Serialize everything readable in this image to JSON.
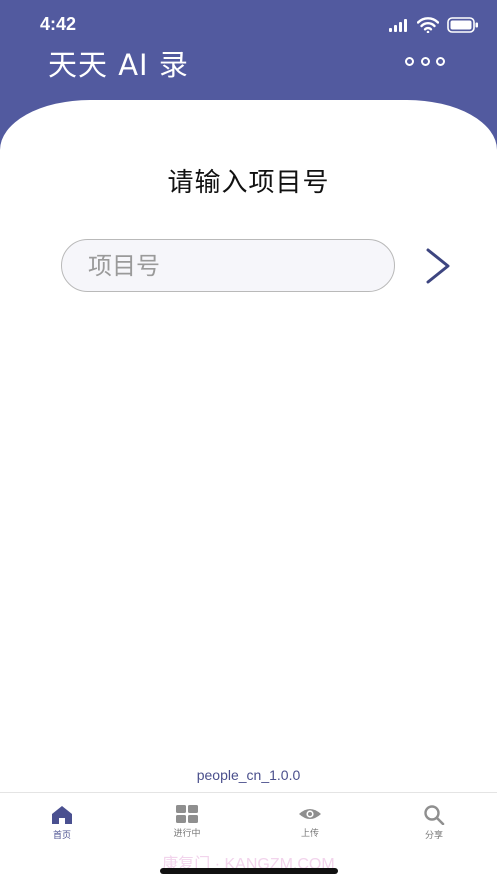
{
  "status_bar": {
    "time": "4:42"
  },
  "header": {
    "title": "天天 AI 录"
  },
  "main": {
    "prompt": "请输入项目号",
    "project_input": {
      "placeholder": "项目号",
      "value": ""
    }
  },
  "footer": {
    "version": "people_cn_1.0.0"
  },
  "tabs": [
    {
      "label": "首页",
      "icon": "home-icon",
      "active": true
    },
    {
      "label": "进行中",
      "icon": "grid-icon",
      "active": false
    },
    {
      "label": "上传",
      "icon": "eye-icon",
      "active": false
    },
    {
      "label": "分享",
      "icon": "search-icon",
      "active": false
    }
  ],
  "watermark": "康复门 · KANGZM.COM",
  "colors": {
    "header": "#525a9f",
    "accent": "#4a5090",
    "chevron": "#3d4580"
  }
}
